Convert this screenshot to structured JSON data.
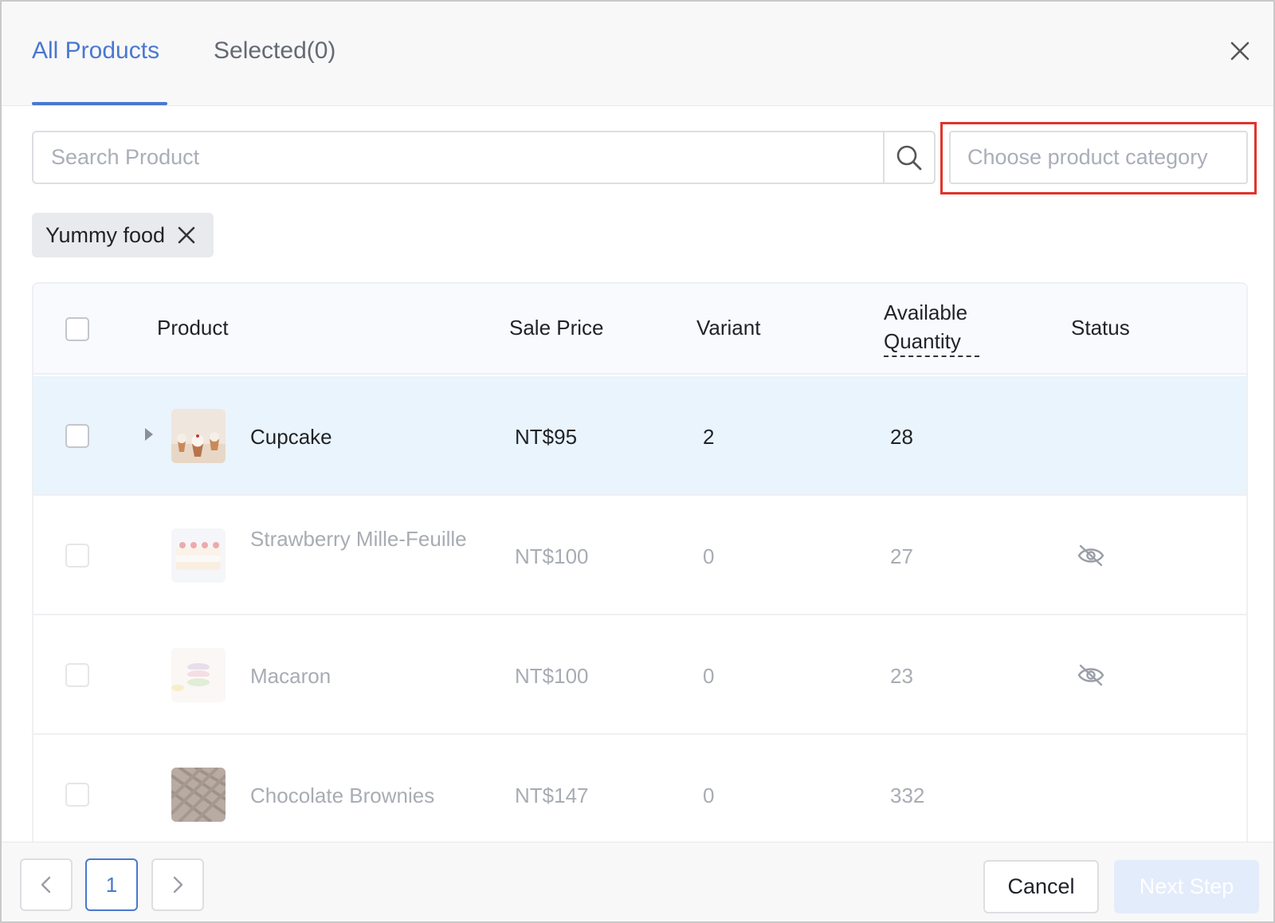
{
  "tabs": {
    "all": "All Products",
    "selected": "Selected(0)"
  },
  "search": {
    "placeholder": "Search Product"
  },
  "category": {
    "placeholder": "Choose product category"
  },
  "filter_tag": {
    "label": "Yummy food"
  },
  "table": {
    "headers": {
      "product": "Product",
      "sale_price": "Sale Price",
      "variant": "Variant",
      "available_quantity": "Available Quantity",
      "status": "Status"
    },
    "rows": [
      {
        "name": "Cupcake",
        "price": "NT$95",
        "variant": "2",
        "quantity": "28",
        "status_icon": "",
        "expandable": true,
        "disabled": false
      },
      {
        "name": "Strawberry Mille-Feuille",
        "price": "NT$100",
        "variant": "0",
        "quantity": "27",
        "status_icon": "eye-off-icon",
        "expandable": false,
        "disabled": true
      },
      {
        "name": "Macaron",
        "price": "NT$100",
        "variant": "0",
        "quantity": "23",
        "status_icon": "eye-off-icon",
        "expandable": false,
        "disabled": true
      },
      {
        "name": "Chocolate Brownies",
        "price": "NT$147",
        "variant": "0",
        "quantity": "332",
        "status_icon": "",
        "expandable": false,
        "disabled": true
      }
    ]
  },
  "pagination": {
    "current_page": "1"
  },
  "buttons": {
    "cancel": "Cancel",
    "next": "Next Step"
  },
  "colors": {
    "accent": "#4a78d0",
    "highlight": "#e0332b",
    "row_hover": "#eaf4fc"
  }
}
